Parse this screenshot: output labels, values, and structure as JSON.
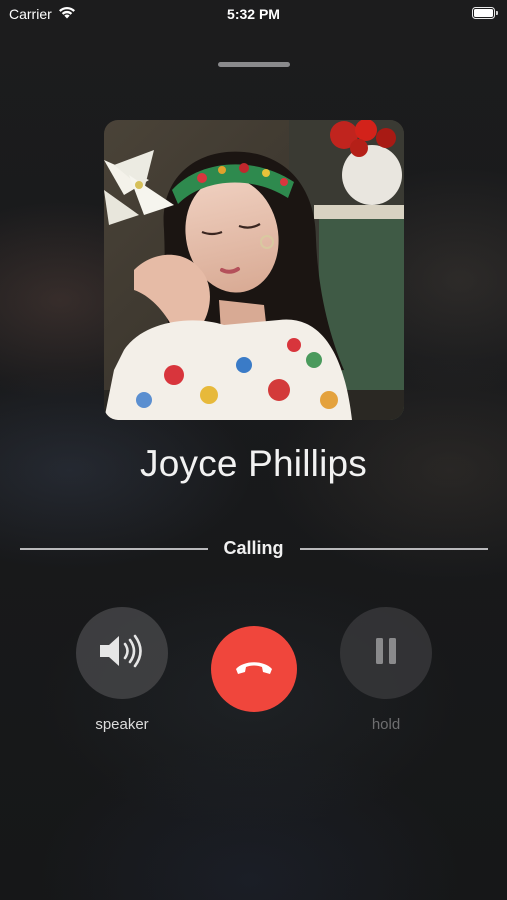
{
  "status_bar": {
    "carrier": "Carrier",
    "time": "5:32 PM",
    "wifi_icon": "wifi-icon",
    "battery_icon": "battery-icon"
  },
  "call": {
    "caller_name": "Joyce Phillips",
    "status": "Calling"
  },
  "controls": {
    "speaker_label": "speaker",
    "hold_label": "hold",
    "speaker_icon": "speaker-icon",
    "end_call_icon": "phone-hangup-icon",
    "hold_icon": "pause-icon"
  },
  "colors": {
    "end_call": "#f0463c",
    "hold_label_disabled": "#6e6e70"
  }
}
